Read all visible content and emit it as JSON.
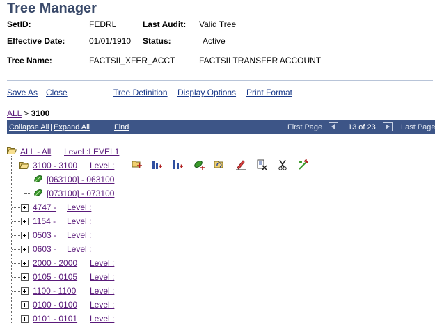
{
  "page": {
    "title": "Tree Manager"
  },
  "fields": {
    "setid_label": "SetID:",
    "setid_value": "FEDRL",
    "last_audit_label": "Last Audit:",
    "last_audit_value": "Valid Tree",
    "effective_date_label": "Effective Date:",
    "effective_date_value": "01/01/1910",
    "status_label": "Status:",
    "status_value": "Active",
    "tree_name_label": "Tree Name:",
    "tree_name_value": "FACTSII_XFER_ACCT",
    "tree_description": "FACTSII TRANSFER ACCOUNT"
  },
  "toolbar_links": {
    "save_as": "Save As",
    "close": "Close",
    "tree_definition": "Tree Definition",
    "display_options": "Display Options",
    "print_format": "Print Format"
  },
  "breadcrumb": {
    "root": "ALL",
    "separator": ">",
    "current": "3100"
  },
  "navbar": {
    "collapse_all": "Collapse All",
    "divider": "|",
    "expand_all": "Expand All",
    "find": "Find",
    "first_page": "First Page",
    "page_info": "13 of 23",
    "last_page": "Last Page",
    "bg_color": "#3d5587"
  },
  "tree": {
    "root": {
      "label": "ALL - All",
      "level": "Level :LEVEL1"
    },
    "node_3100": {
      "label": "3100 - 3100",
      "level": "Level :"
    },
    "leaves": [
      {
        "label": "[063100] - 063100"
      },
      {
        "label": "[073100] - 073100"
      }
    ],
    "siblings": [
      {
        "label": "4747 -",
        "level": "Level :"
      },
      {
        "label": "1154 -",
        "level": "Level :"
      },
      {
        "label": "0503 -",
        "level": "Level :"
      },
      {
        "label": "0603 -",
        "level": "Level :"
      },
      {
        "label": "2000 - 2000",
        "level": "Level :"
      },
      {
        "label": "0105 - 0105",
        "level": "Level :"
      },
      {
        "label": "1100 - 1100",
        "level": "Level :"
      },
      {
        "label": "0100 - 0100",
        "level": "Level :"
      },
      {
        "label": "0101 - 0101",
        "level": "Level :"
      }
    ]
  },
  "node_actions": [
    "insert-sibling-icon",
    "insert-child-icon",
    "insert-child-alt-icon",
    "insert-detail-icon",
    "move-node-icon",
    "edit-data-icon",
    "delete-icon",
    "cut-icon",
    "paste-icon"
  ],
  "colors": {
    "link": "#5a1a7a",
    "title": "#3a4a6a",
    "leaf_green": "#3a9a2a",
    "folder_yellow": "#f0d070"
  }
}
